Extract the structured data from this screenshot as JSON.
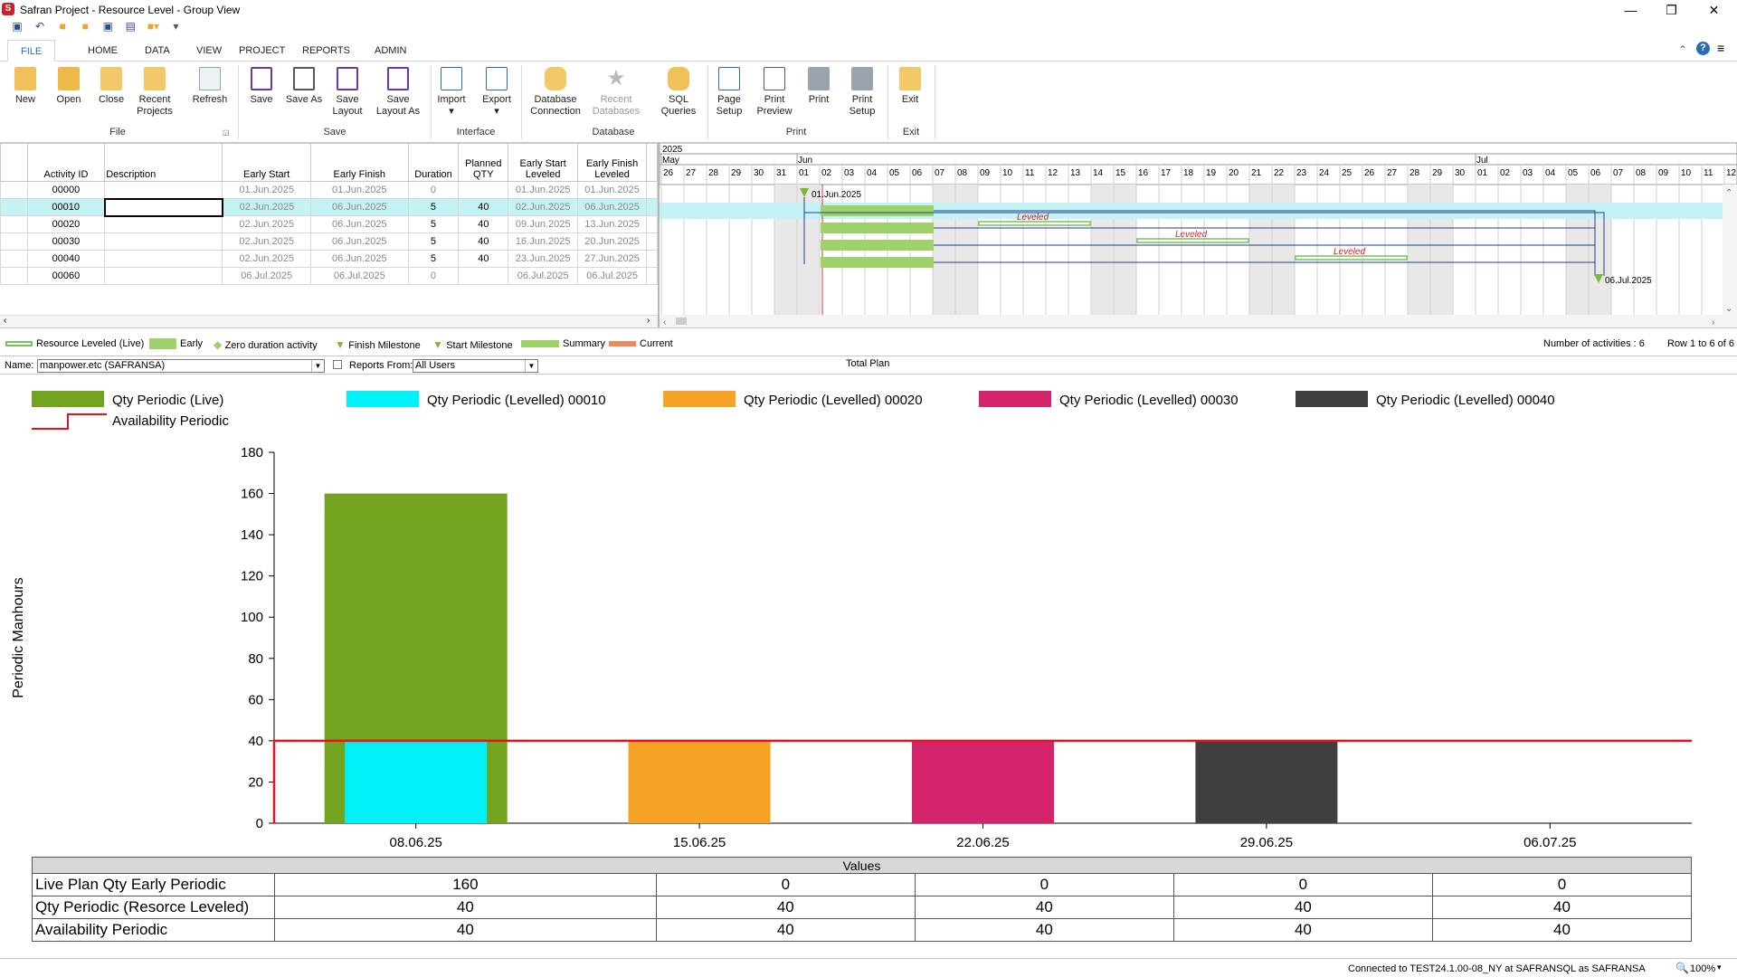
{
  "window": {
    "title": "Safran Project - Resource Level - Group View",
    "minimize": "—",
    "restore": "❐",
    "close": "✕"
  },
  "qat": [
    "save",
    "undo",
    "open",
    "open2",
    "save2",
    "print",
    "more"
  ],
  "tabs": [
    "FILE",
    "HOME",
    "DATA",
    "VIEW",
    "PROJECT",
    "REPORTS",
    "ADMIN"
  ],
  "ribbon": {
    "buttons": [
      {
        "label": "New",
        "icon": "new-icon"
      },
      {
        "label": "Open",
        "icon": "open-icon"
      },
      {
        "label": "Close",
        "icon": "close-folder-icon"
      },
      {
        "label": "Recent Projects",
        "icon": "recent-projects-icon"
      },
      {
        "label": "Refresh",
        "icon": "refresh-icon"
      },
      {
        "label": "Save",
        "icon": "save-icon"
      },
      {
        "label": "Save As",
        "icon": "save-as-icon"
      },
      {
        "label": "Save Layout",
        "icon": "save-layout-icon"
      },
      {
        "label": "Save Layout As",
        "icon": "save-layout-as-icon"
      },
      {
        "label": "Import",
        "icon": "import-icon"
      },
      {
        "label": "Export",
        "icon": "export-icon"
      },
      {
        "label": "Database Connection",
        "icon": "database-icon"
      },
      {
        "label": "Recent Databases",
        "icon": "recent-db-icon"
      },
      {
        "label": "SQL Queries",
        "icon": "sql-icon"
      },
      {
        "label": "Page Setup",
        "icon": "page-setup-icon"
      },
      {
        "label": "Print Preview",
        "icon": "print-preview-icon"
      },
      {
        "label": "Print",
        "icon": "print-icon"
      },
      {
        "label": "Print Setup",
        "icon": "print-setup-icon"
      },
      {
        "label": "Exit",
        "icon": "exit-icon"
      }
    ],
    "groups": [
      "File",
      "Save",
      "Interface",
      "Database",
      "Print",
      "Exit"
    ]
  },
  "grid": {
    "headers": [
      "Activity ID",
      "Description",
      "Early Start",
      "Early Finish",
      "Duration",
      "Planned QTY",
      "Early Start Leveled",
      "Early Finish Leveled"
    ],
    "rows": [
      {
        "id": "00000",
        "desc": "",
        "es": "01.Jun.2025",
        "ef": "01.Jun.2025",
        "dur": "0",
        "qty": "",
        "esl": "01.Jun.2025",
        "efl": "01.Jun.2025"
      },
      {
        "id": "00010",
        "desc": "",
        "es": "02.Jun.2025",
        "ef": "06.Jun.2025",
        "dur": "5",
        "qty": "40",
        "esl": "02.Jun.2025",
        "efl": "06.Jun.2025"
      },
      {
        "id": "00020",
        "desc": "",
        "es": "02.Jun.2025",
        "ef": "06.Jun.2025",
        "dur": "5",
        "qty": "40",
        "esl": "09.Jun.2025",
        "efl": "13.Jun.2025"
      },
      {
        "id": "00030",
        "desc": "",
        "es": "02.Jun.2025",
        "ef": "06.Jun.2025",
        "dur": "5",
        "qty": "40",
        "esl": "16.Jun.2025",
        "efl": "20.Jun.2025"
      },
      {
        "id": "00040",
        "desc": "",
        "es": "02.Jun.2025",
        "ef": "06.Jun.2025",
        "dur": "5",
        "qty": "40",
        "esl": "23.Jun.2025",
        "efl": "27.Jun.2025"
      },
      {
        "id": "00060",
        "desc": "",
        "es": "06.Jul.2025",
        "ef": "06.Jul.2025",
        "dur": "0",
        "qty": "",
        "esl": "06.Jul.2025",
        "efl": "06.Jul.2025"
      }
    ]
  },
  "gantt": {
    "year": "2025",
    "months": [
      "May",
      "Jun",
      "Jul"
    ],
    "days": [
      "26",
      "27",
      "28",
      "29",
      "30",
      "31",
      "01",
      "02",
      "03",
      "04",
      "05",
      "06",
      "07",
      "08",
      "09",
      "10",
      "11",
      "12",
      "13",
      "14",
      "15",
      "16",
      "17",
      "18",
      "19",
      "20",
      "21",
      "22",
      "23",
      "24",
      "25",
      "26",
      "27",
      "28",
      "29",
      "30",
      "01",
      "02",
      "03",
      "04",
      "05",
      "06",
      "07",
      "08",
      "09",
      "10",
      "11",
      "12"
    ],
    "start_milestone_label": "01.Jun.2025",
    "finish_milestone_label": "06.Jul.2025",
    "leveled_label": "Leveled"
  },
  "legend": {
    "items": [
      "Resource Leveled (Live)",
      "Early",
      "Zero duration activity",
      "Finish Milestone",
      "Start Milestone",
      "Summary",
      "Current"
    ],
    "count": "Number of activities : 6",
    "rows": "Row 1 to 6 of 6"
  },
  "filter": {
    "name_label": "Name:",
    "name_value": "manpower.etc (SAFRANSA)",
    "reports_label": "Reports From:",
    "reports_value": "All Users",
    "total_plan": "Total Plan"
  },
  "chart_data": {
    "type": "bar",
    "ylabel": "Periodic Manhours",
    "ylim": [
      0,
      180
    ],
    "yticks": [
      "0",
      "20",
      "40",
      "60",
      "80",
      "100",
      "120",
      "140",
      "160",
      "180"
    ],
    "categories": [
      "08.06.25",
      "15.06.25",
      "22.06.25",
      "29.06.25",
      "06.07.25"
    ],
    "series": [
      {
        "name": "Qty Periodic (Live)",
        "color": "#72a41f",
        "values": [
          160,
          0,
          0,
          0,
          0
        ]
      },
      {
        "name": "Qty Periodic (Levelled) 00010",
        "color": "#00f2f8",
        "values": [
          40,
          0,
          0,
          0,
          0
        ]
      },
      {
        "name": "Qty Periodic (Levelled) 00020",
        "color": "#f7a325",
        "values": [
          0,
          40,
          0,
          0,
          0
        ]
      },
      {
        "name": "Qty Periodic (Levelled) 00030",
        "color": "#d4246c",
        "values": [
          0,
          0,
          40,
          0,
          0
        ]
      },
      {
        "name": "Qty Periodic (Levelled) 00040",
        "color": "#404040",
        "values": [
          0,
          0,
          0,
          40,
          0
        ]
      }
    ],
    "line": {
      "name": "Availability Periodic",
      "color": "#e8131a",
      "values": [
        40,
        40,
        40,
        40,
        40
      ]
    },
    "grid": false,
    "legend": "top"
  },
  "values_table": {
    "header": "Values",
    "rows": [
      {
        "label": "Live Plan Qty Early Periodic",
        "values": [
          "160",
          "0",
          "0",
          "0",
          "0"
        ]
      },
      {
        "label": "Qty Periodic (Resorce Leveled)",
        "values": [
          "40",
          "40",
          "40",
          "40",
          "40"
        ]
      },
      {
        "label": "Availability Periodic",
        "values": [
          "40",
          "40",
          "40",
          "40",
          "40"
        ]
      }
    ]
  },
  "status": {
    "connection": "Connected to TEST24.1.00-08_NY at SAFRANSQL as SAFRANSA",
    "zoom": "100%"
  }
}
